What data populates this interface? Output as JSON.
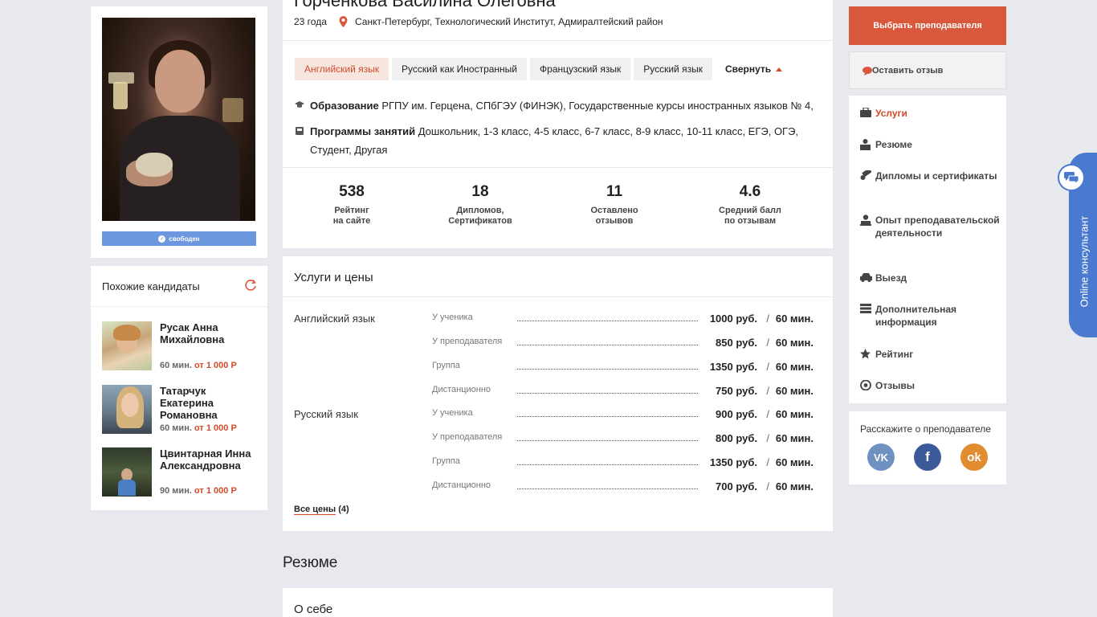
{
  "profile": {
    "name": "Горченкова Василина Олеговна",
    "age": "23 года",
    "location": "Санкт-Петербург, Технологический Институт, Адмиралтейский район",
    "status_badge": "свободен",
    "subjects_tabs": [
      "Английский язык",
      "Русский как Иностранный",
      "Французский язык",
      "Русский язык"
    ],
    "collapse_label": "Свернуть",
    "education_label": "Образование",
    "education_value": "РГПУ им. Герцена, СПбГЭУ (ФИНЭК), Государственные курсы иностранных языков № 4,",
    "programs_label": "Программы занятий",
    "programs_value_line1": "Дошкольник, 1-3 класс, 4-5 класс, 6-7 класс, 8-9 класс, 10-11 класс, ЕГЭ, ОГЭ,",
    "programs_value_line2": "Студент, Другая",
    "stats": [
      {
        "value": "538",
        "label_1": "Рейтинг",
        "label_2": "на сайте"
      },
      {
        "value": "18",
        "label_1": "Дипломов,",
        "label_2": "Сертификатов"
      },
      {
        "value": "11",
        "label_1": "Оставлено",
        "label_2": "отзывов"
      },
      {
        "value": "4.6",
        "label_1": "Средний балл",
        "label_2": "по отзывам"
      }
    ]
  },
  "similar": {
    "title": "Похожие кандидаты",
    "candidates": [
      {
        "name_1": "Русак Анна",
        "name_2": "Михайловна",
        "duration": "60 мин.",
        "price": "от 1 000 Р"
      },
      {
        "name_1": "Татарчук",
        "name_2": "Екатерина",
        "name_3": "Романовна",
        "duration": "60 мин.",
        "price": "от 1 000 Р"
      },
      {
        "name_1": "Цвинтарная Инна",
        "name_2": "Александровна",
        "duration": "90 мин.",
        "price": "от 1 000 Р"
      }
    ]
  },
  "prices": {
    "title": "Услуги и цены",
    "subjects": [
      {
        "name": "Английский язык",
        "rows": [
          {
            "kind": "У ученика",
            "amount": "1000 руб.",
            "duration": "60 мин."
          },
          {
            "kind": "У преподавателя",
            "amount": "850 руб.",
            "duration": "60 мин."
          },
          {
            "kind": "Группа",
            "amount": "1350 руб.",
            "duration": "60 мин."
          },
          {
            "kind": "Дистанционно",
            "amount": "750 руб.",
            "duration": "60 мин."
          }
        ]
      },
      {
        "name": "Русский язык",
        "rows": [
          {
            "kind": "У ученика",
            "amount": "900 руб.",
            "duration": "60 мин."
          },
          {
            "kind": "У преподавателя",
            "amount": "800 руб.",
            "duration": "60 мин."
          },
          {
            "kind": "Группа",
            "amount": "1350 руб.",
            "duration": "60 мин."
          },
          {
            "kind": "Дистанционно",
            "amount": "700 руб.",
            "duration": "60 мин."
          }
        ]
      }
    ],
    "separator": "/",
    "all_prices_label": "Все цены",
    "all_prices_count": "(4)"
  },
  "resume": {
    "heading": "Резюме",
    "about_title": "О себе"
  },
  "sidebar": {
    "choose_button": "Выбрать преподавателя",
    "review_button": "Оставить отзыв",
    "nav": [
      {
        "label": "Услуги",
        "icon": "services-icon"
      },
      {
        "label": "Резюме",
        "icon": "resume-icon"
      },
      {
        "label": "Дипломы и сертификаты",
        "icon": "diploma-icon"
      },
      {
        "label": "Опыт преподавательской деятельности",
        "icon": "teacher-icon"
      },
      {
        "label": "Выезд",
        "icon": "car-icon"
      },
      {
        "label": "Дополнительная информация",
        "icon": "info-icon"
      },
      {
        "label": "Рейтинг",
        "icon": "star-icon"
      },
      {
        "label": "Отзывы",
        "icon": "eye-icon"
      }
    ],
    "share_title": "Расскажите о преподавателе",
    "social": {
      "vk": "VK",
      "fb": "f",
      "ok": "ok"
    }
  },
  "consultant": {
    "label": "Online консультант"
  },
  "colors": {
    "accent": "#d9573a",
    "link_red": "#d04a2a",
    "badge_blue": "#6b97de",
    "consultant_blue": "#4a7ad0"
  }
}
